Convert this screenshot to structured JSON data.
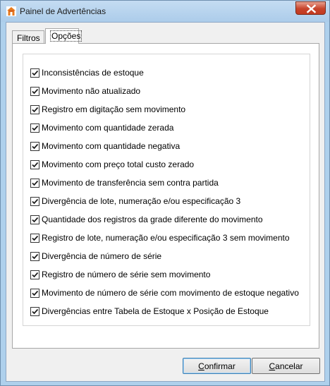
{
  "window": {
    "title": "Painel de Advertências"
  },
  "tabs": [
    {
      "label": "Filtros",
      "active": false
    },
    {
      "label": "Opções",
      "active": true
    }
  ],
  "options": [
    {
      "label": "Inconsistências de estoque",
      "checked": true
    },
    {
      "label": "Movimento não atualizado",
      "checked": true
    },
    {
      "label": "Registro em digitação sem movimento",
      "checked": true
    },
    {
      "label": "Movimento com quantidade zerada",
      "checked": true
    },
    {
      "label": "Movimento com quantidade negativa",
      "checked": true
    },
    {
      "label": "Movimento com preço total custo zerado",
      "checked": true
    },
    {
      "label": "Movimento de transferência sem contra partida",
      "checked": true
    },
    {
      "label": "Divergência de lote, numeração e/ou especificação 3",
      "checked": true
    },
    {
      "label": "Quantidade dos registros da grade diferente do movimento",
      "checked": true
    },
    {
      "label": "Registro de lote, numeração e/ou especificação 3 sem movimento",
      "checked": true
    },
    {
      "label": "Divergência de número de série",
      "checked": true
    },
    {
      "label": "Registro de número de série sem movimento",
      "checked": true
    },
    {
      "label": "Movimento de número de série com movimento de estoque negativo",
      "checked": true
    },
    {
      "label": "Divergências entre Tabela de Estoque x Posição de Estoque",
      "checked": true
    }
  ],
  "buttons": {
    "confirm_accel": "C",
    "confirm_rest": "onfirmar",
    "cancel_accel": "C",
    "cancel_rest": "ancelar"
  }
}
